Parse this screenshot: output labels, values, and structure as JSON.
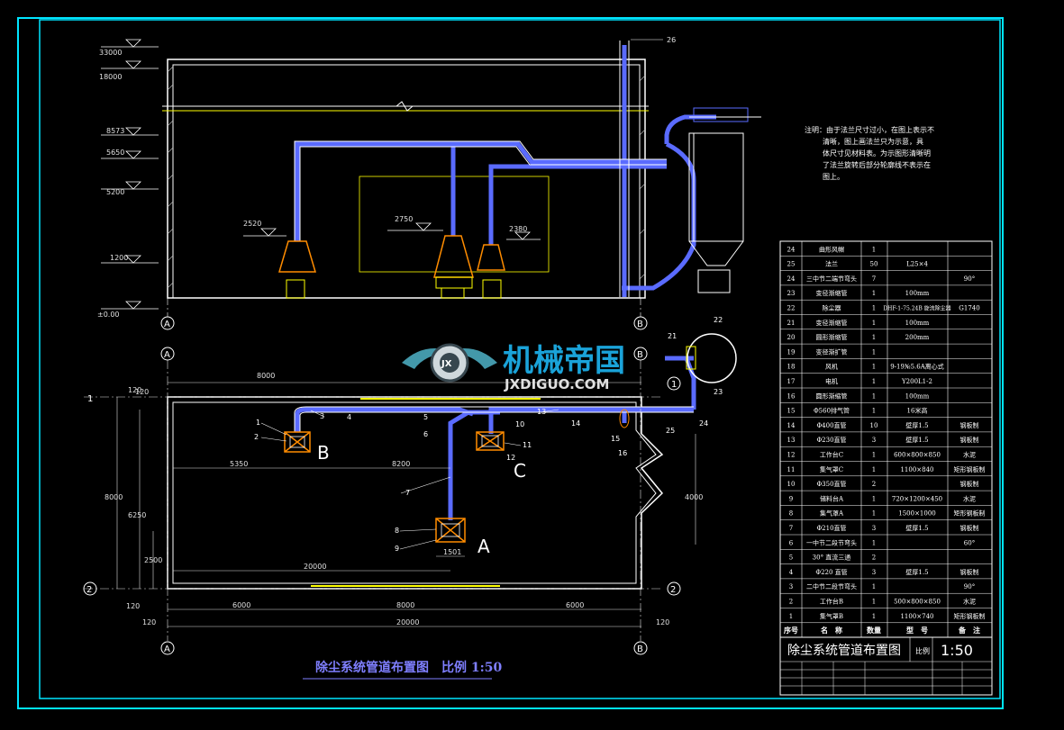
{
  "drawing": {
    "title_bottom": "除尘系统管道布置图　比例 1:50",
    "title_block": {
      "name": "除尘系统管道布置图",
      "scale_label": "比例",
      "scale": "1:50"
    }
  },
  "elevation": {
    "levels": [
      "33000",
      "18000",
      "8573",
      "5650",
      "5200",
      "1200",
      "±0.00"
    ],
    "hood_levels": [
      "2520",
      "2750",
      "2380"
    ],
    "item_26": "26"
  },
  "notes": {
    "lines": [
      "注明：由于法兰尺寸过小，在图上表示不",
      "清晰，图上画法兰只为示意，具",
      "体尺寸见材料表。为示图形清晰明",
      "了法兰旋转后部分轮廓线不表示在",
      "图上。"
    ]
  },
  "plan": {
    "grid": [
      "A",
      "B",
      "1",
      "2"
    ],
    "dims": {
      "d8000_top": "8000",
      "d120": "120",
      "d5350": "5350",
      "d8200": "8200",
      "d1501": "1501",
      "d20000_in": "20000",
      "d6000_l": "6000",
      "d8000_b": "8000",
      "d6000_r": "6000",
      "d20000_b": "20000",
      "d120_l": "120",
      "d120_r": "120",
      "d8000_v": "8000",
      "d6250": "6250",
      "d2500": "2500",
      "d4000": "4000",
      "d120_v": "120",
      "d120_vb": "120"
    },
    "zones": [
      "A",
      "B",
      "C"
    ],
    "callouts": [
      "1",
      "2",
      "3",
      "4",
      "5",
      "6",
      "7",
      "8",
      "9",
      "10",
      "11",
      "12",
      "13",
      "14",
      "15",
      "16",
      "21",
      "22",
      "23",
      "24",
      "25"
    ]
  },
  "watermark": {
    "cn": "机械帝国",
    "en": "JXDIGUO.COM",
    "badge": "JX"
  },
  "bom": {
    "header": [
      "序号",
      "名　称",
      "数量",
      "型　号",
      "备　注"
    ],
    "rows": [
      [
        "24",
        "曲形风帽",
        "1",
        "",
        ""
      ],
      [
        "25",
        "法兰",
        "50",
        "L25×4",
        ""
      ],
      [
        "24",
        "三中节二端节弯头",
        "7",
        "",
        "90°"
      ],
      [
        "23",
        "变径渐缩管",
        "1",
        "100mm",
        ""
      ],
      [
        "22",
        "除尘器",
        "1",
        "DHF-1-75.24B 旋流除尘器",
        "G1740"
      ],
      [
        "21",
        "变径渐缩管",
        "1",
        "100mm",
        ""
      ],
      [
        "20",
        "圆形渐缩管",
        "1",
        "200mm",
        ""
      ],
      [
        "19",
        "变径渐扩管",
        "1",
        "",
        ""
      ],
      [
        "18",
        "风机",
        "1",
        "9-19№5.6A离心式",
        ""
      ],
      [
        "17",
        "电机",
        "1",
        "Y200L1-2",
        ""
      ],
      [
        "16",
        "圆形渐缩管",
        "1",
        "100mm",
        ""
      ],
      [
        "15",
        "Φ560排气管",
        "1",
        "16米高",
        ""
      ],
      [
        "14",
        "Φ400直管",
        "10",
        "壁厚1.5",
        "钢板制"
      ],
      [
        "13",
        "Φ230直管",
        "3",
        "壁厚1.5",
        "钢板制"
      ],
      [
        "12",
        "工作台C",
        "1",
        "600×800×850",
        "水泥"
      ],
      [
        "11",
        "集气罩C",
        "1",
        "1100×840",
        "矩形钢板制"
      ],
      [
        "10",
        "Φ350直管",
        "2",
        "",
        "钢板制"
      ],
      [
        "9",
        "储料台A",
        "1",
        "720×1200×450",
        "水泥"
      ],
      [
        "8",
        "集气罩A",
        "1",
        "1500×1000",
        "矩形钢板制"
      ],
      [
        "7",
        "Φ210直管",
        "3",
        "壁厚1.5",
        "钢板制"
      ],
      [
        "6",
        "一中节二段节弯头",
        "1",
        "",
        "60°"
      ],
      [
        "5",
        "30° 直流三通",
        "2",
        "",
        ""
      ],
      [
        "4",
        "Φ220 直管",
        "3",
        "壁厚1.5",
        "钢板制"
      ],
      [
        "3",
        "二中节二段节弯头",
        "1",
        "",
        "90°"
      ],
      [
        "2",
        "工作台B",
        "1",
        "500×800×850",
        "水泥"
      ],
      [
        "1",
        "集气罩B",
        "1",
        "1100×740",
        "矩形钢板制"
      ]
    ]
  },
  "colors": {
    "frame": "#00e5ff",
    "line": "#e8e8e8",
    "duct": "#5a6bff",
    "hood": "#ff8c00",
    "accent": "#ffff00",
    "text": "#ffffff",
    "dim": "#e0e0e0",
    "title": "#7f7fff"
  }
}
